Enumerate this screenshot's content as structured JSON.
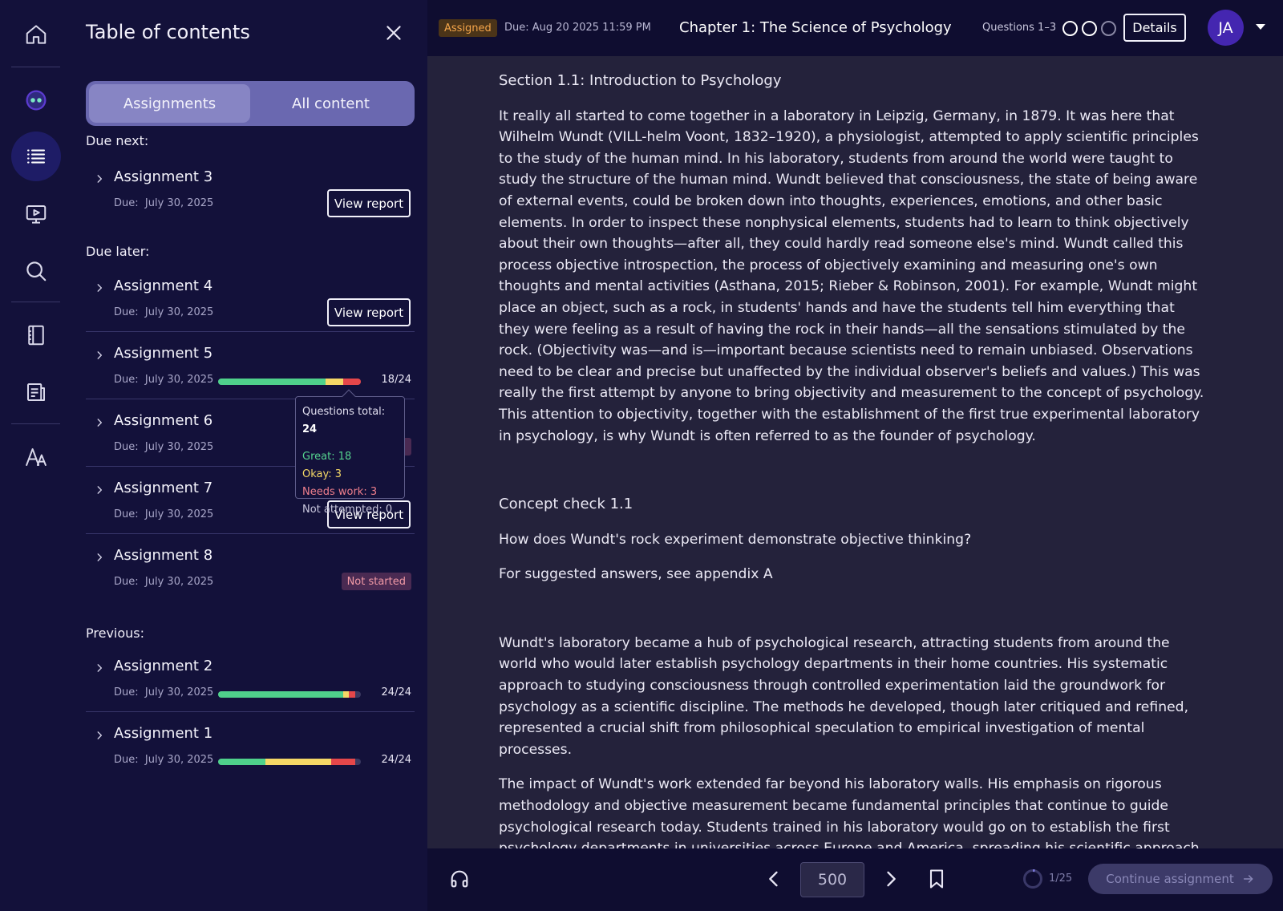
{
  "toc": {
    "title": "Table of contents",
    "tabs": [
      "Assignments",
      "All content"
    ],
    "groups": {
      "due_next": "Due next:",
      "due_later": "Due later:",
      "previous": "Previous:"
    },
    "view_report_label": "View report",
    "not_started_label": "Not started",
    "due_prefix": "Due:",
    "assignments": [
      {
        "name": "Assignment 3",
        "due": "July 30, 2025",
        "status": "report"
      },
      {
        "name": "Assignment 4",
        "due": "July 30, 2025",
        "status": "report"
      },
      {
        "name": "Assignment 5",
        "due": "July 30, 2025",
        "status": "progress",
        "count": "18/24",
        "great": 18,
        "okay": 3,
        "needs_work": 3,
        "not_attempted": 0,
        "total": 24
      },
      {
        "name": "Assignment 6",
        "due": "July 30, 2025",
        "status": "not_started"
      },
      {
        "name": "Assignment 7",
        "due": "July 30, 2025",
        "status": "report"
      },
      {
        "name": "Assignment 8",
        "due": "July 30, 2025",
        "status": "not_started"
      },
      {
        "name": "Assignment 2",
        "due": "July 30, 2025",
        "status": "progress",
        "count": "24/24",
        "great": 21,
        "okay": 1,
        "needs_work": 1,
        "not_attempted": 0,
        "total": 24
      },
      {
        "name": "Assignment 1",
        "due": "July 30, 2025",
        "status": "progress",
        "count": "24/24",
        "great": 8,
        "okay": 11,
        "needs_work": 4,
        "not_attempted": 0,
        "total": 24
      }
    ],
    "tooltip": {
      "total_label": "Questions total:",
      "total": "24",
      "great_label": "Great:",
      "great": "18",
      "okay_label": "Okay:",
      "okay": "3",
      "needs_label": "Needs work:",
      "needs": "3",
      "na_label": "Not attempted:",
      "na": "0"
    }
  },
  "topbar": {
    "status_badge": "Assigned",
    "due": "Due: Aug 20 2025 11:59 PM",
    "chapter_title": "Chapter 1: The Science of Psychology",
    "questions_label": "Questions 1–3",
    "details_label": "Details",
    "avatar_initials": "JA"
  },
  "reader": {
    "section_heading": "Section 1.1: Introduction to Psychology",
    "para1": "It really all started to come together in a laboratory in Leipzig, Germany, in 1879. It was here that Wilhelm Wundt (VILL-helm Voont, 1832–1920), a physiologist, attempted to apply scientific principles to the study of the human mind. In his laboratory, students from around the world were taught to study the structure of the human mind. Wundt believed that consciousness, the state of being aware of external events, could be broken down into thoughts, experiences, emotions, and other basic elements. In order to inspect these nonphysical elements, students had to learn to think objectively about their own thoughts—after all, they could hardly read someone else's mind. Wundt called this process objective introspection, the process of objectively examining and measuring one's own thoughts and mental activities (Asthana, 2015; Rieber & Robinson, 2001). For example, Wundt might place an object, such as a rock, in students' hands and have the students tell him everything that they were feeling as a result of having the rock in their hands—all the sensations stimulated by the rock. (Objectivity was—and is—important because scientists need to remain unbiased. Observations need to be clear and precise but unaffected by the individual observer's beliefs and values.) This was really the first attempt by anyone to bring objectivity and measurement to the concept of psychology. This attention to objectivity, together with the establishment of the first true experimental laboratory in psychology, is why Wundt is often referred to as the founder of psychology.",
    "concept_heading": "Concept check 1.1",
    "concept_question": "How does Wundt's rock experiment demonstrate objective thinking?",
    "concept_answer": "For suggested answers, see appendix A",
    "para2": "Wundt's laboratory became a hub of psychological research, attracting students from around the world who would later establish psychology departments in their home countries. His systematic approach to studying consciousness through controlled experimentation laid the groundwork for psychology as a scientific discipline. The methods he developed, though later critiqued and refined, represented a crucial shift from philosophical speculation to empirical investigation of mental processes.",
    "para3": "The impact of Wundt's work extended far beyond his laboratory walls. His emphasis on rigorous methodology and objective measurement became fundamental principles that continue to guide psychological research today. Students trained in his laboratory would go on to establish the first psychology departments in universities across Europe and America, spreading his scientific approach to the study of mind and behavior."
  },
  "bottombar": {
    "page_placeholder": "500",
    "progress_text": "1/25",
    "continue_label": "Continue assignment"
  },
  "colors": {
    "accent": "#4426b0",
    "great": "#4fd18b",
    "okay": "#f5d866",
    "needs_work": "#e5474a",
    "assigned": "#f4a54a"
  }
}
